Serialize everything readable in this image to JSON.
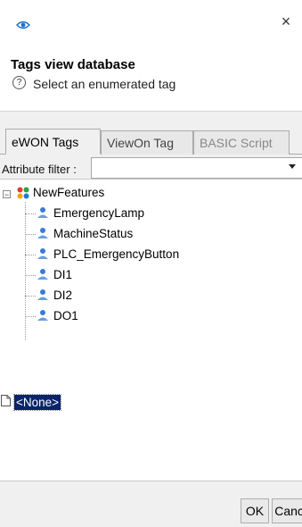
{
  "window": {
    "icon": "eye-icon",
    "close_symbol": "×"
  },
  "header": {
    "title": "Tags view database",
    "instruction": "Select an enumerated tag",
    "help_symbol": "?"
  },
  "tabs": [
    {
      "label": "eWON Tags",
      "state": "active"
    },
    {
      "label": "ViewOn Tag",
      "state": "inactive"
    },
    {
      "label": "BASIC Script",
      "state": "disabled"
    }
  ],
  "filter": {
    "label": "Attribute filter :",
    "value": ""
  },
  "tree": {
    "group": {
      "label": "NewFeatures",
      "expander": "−",
      "children": [
        "EmergencyLamp",
        "MachineStatus",
        "PLC_EmergencyButton",
        "DI1",
        "DI2",
        "DO1"
      ]
    },
    "none_item": "<None>"
  },
  "buttons": {
    "ok": "OK",
    "cancel": "Cancel"
  },
  "colors": {
    "selection": "#0a246a",
    "eye_icon": "#1a6fd0"
  }
}
